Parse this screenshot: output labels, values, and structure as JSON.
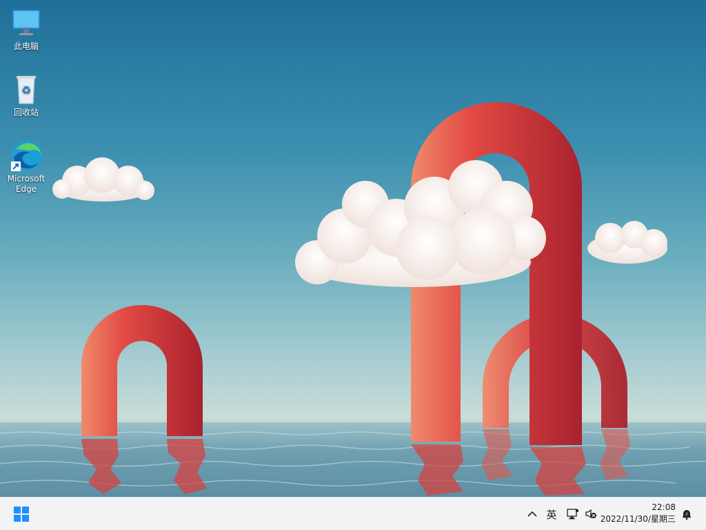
{
  "desktop": {
    "icons": [
      {
        "label": "此电脑",
        "icon": "this-pc-icon"
      },
      {
        "label": "回收站",
        "icon": "recycle-bin-icon"
      },
      {
        "label": "Microsoft Edge",
        "icon": "edge-icon"
      }
    ]
  },
  "taskbar": {
    "start_icon": "windows-start-icon",
    "tray": {
      "overflow_icon": "chevron-up-icon",
      "ime_label": "英",
      "network_icon": "network-icon",
      "volume_icon": "volume-muted-icon",
      "notification_icon": "notification-bell-icon"
    },
    "clock": {
      "time": "22:08",
      "date": "2022/11/30/星期三"
    }
  },
  "colors": {
    "sky_top": "#1f6f98",
    "sky_bottom": "#b9d3d6",
    "arch": "#d9383a",
    "start_blue": "#1e90ff",
    "taskbar": "#f1f3f4"
  }
}
